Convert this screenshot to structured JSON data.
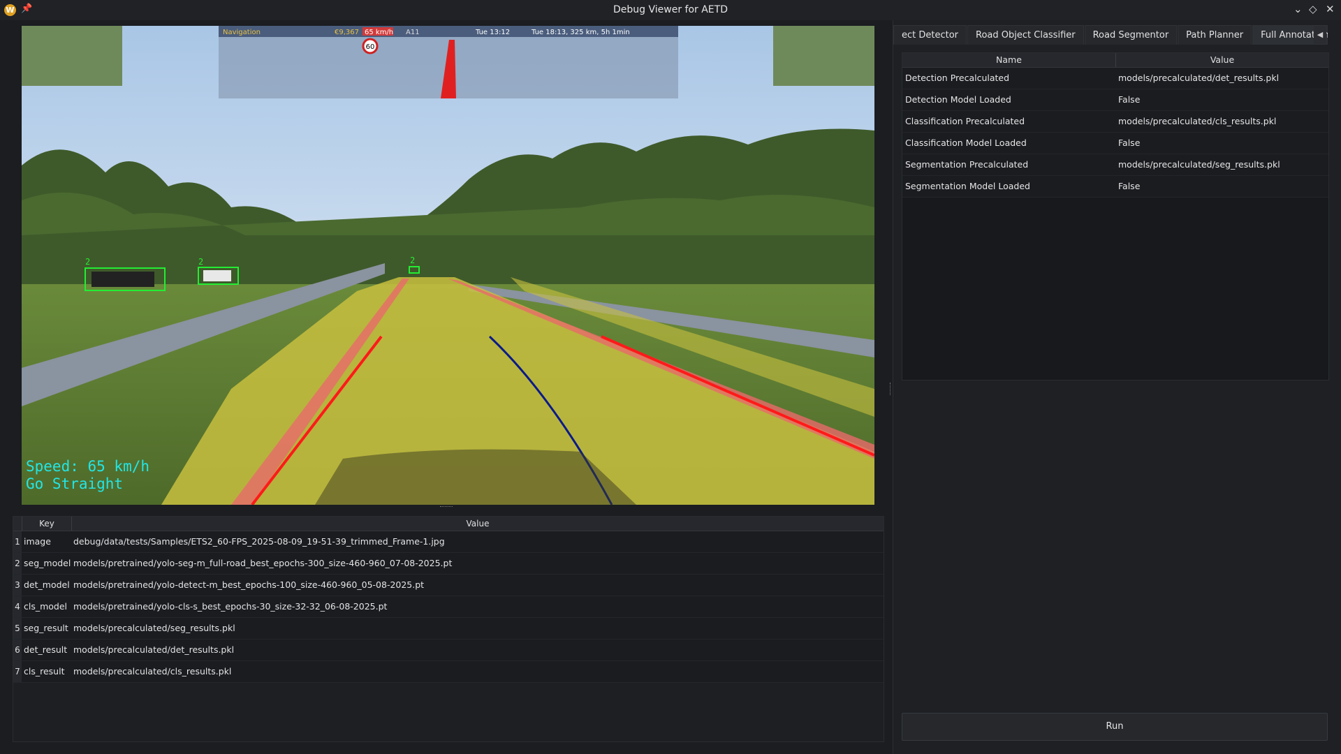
{
  "window": {
    "title": "Debug Viewer for AETD",
    "app_icon": "W"
  },
  "game_hud": {
    "nav_label": "Navigation",
    "money": "€9,367",
    "speed_badge": "65 km/h",
    "road": "A11",
    "time": "Tue 13:12",
    "destination": "Tue 18:13, 325 km, 5h 1min",
    "speed_limit": "60"
  },
  "detections": [
    {
      "class_label": "2"
    },
    {
      "class_label": "2"
    },
    {
      "class_label": "2"
    }
  ],
  "overlay": {
    "speed_text": "Speed: 65 km/h",
    "direction_text": "Go Straight"
  },
  "kv_table": {
    "headers": {
      "key": "Key",
      "value": "Value"
    },
    "rows": [
      {
        "idx": "1",
        "key": "image",
        "value": "debug/data/tests/Samples/ETS2_60-FPS_2025-08-09_19-51-39_trimmed_Frame-1.jpg"
      },
      {
        "idx": "2",
        "key": "seg_model",
        "value": "models/pretrained/yolo-seg-m_full-road_best_epochs-300_size-460-960_07-08-2025.pt"
      },
      {
        "idx": "3",
        "key": "det_model",
        "value": "models/pretrained/yolo-detect-m_best_epochs-100_size-460-960_05-08-2025.pt"
      },
      {
        "idx": "4",
        "key": "cls_model",
        "value": "models/pretrained/yolo-cls-s_best_epochs-30_size-32-32_06-08-2025.pt"
      },
      {
        "idx": "5",
        "key": "seg_result",
        "value": "models/precalculated/seg_results.pkl"
      },
      {
        "idx": "6",
        "key": "det_result",
        "value": "models/precalculated/det_results.pkl"
      },
      {
        "idx": "7",
        "key": "cls_result",
        "value": "models/precalculated/cls_results.pkl"
      }
    ]
  },
  "tabs": [
    {
      "label": "ect Detector",
      "active": false
    },
    {
      "label": "Road Object Classifier",
      "active": false
    },
    {
      "label": "Road Segmentor",
      "active": false
    },
    {
      "label": "Path Planner",
      "active": false
    },
    {
      "label": "Full Annotation Pipeline",
      "active": true
    }
  ],
  "params_table": {
    "headers": {
      "name": "Name",
      "value": "Value"
    },
    "rows": [
      {
        "name": "Detection Precalculated",
        "value": "models/precalculated/det_results.pkl"
      },
      {
        "name": "Detection Model Loaded",
        "value": "False"
      },
      {
        "name": "Classification Precalculated",
        "value": "models/precalculated/cls_results.pkl"
      },
      {
        "name": "Classification Model Loaded",
        "value": "False"
      },
      {
        "name": "Segmentation Precalculated",
        "value": "models/precalculated/seg_results.pkl"
      },
      {
        "name": "Segmentation Model Loaded",
        "value": "False"
      }
    ]
  },
  "run_button": "Run",
  "colors": {
    "detection_box": "#22ee33",
    "overlay_text": "#22e6e6",
    "road_mask": "#c8c040",
    "lane_line": "#ff1a1a",
    "planned_path": "#0a1a8a"
  }
}
